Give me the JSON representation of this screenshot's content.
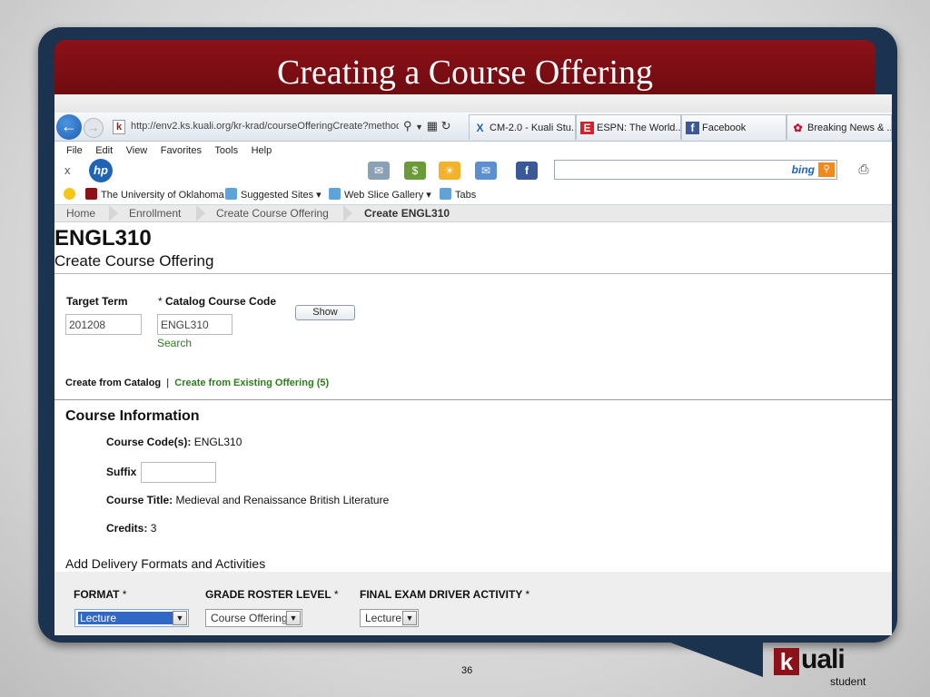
{
  "slide": {
    "title": "Creating a Course Offering",
    "page_number": "36"
  },
  "browser": {
    "url": "http://env2.ks.kuali.org/kr-krad/courseOfferingCreate?method",
    "tabs": [
      {
        "label": "CM-2.0 - Kuali Stu...",
        "icon": "kuali-x-icon"
      },
      {
        "label": "ESPN: The World...",
        "icon": "espn-icon"
      },
      {
        "label": "Facebook",
        "icon": "facebook-icon"
      },
      {
        "label": "Breaking News & ...",
        "icon": "nbc-icon"
      }
    ],
    "menu": [
      "File",
      "Edit",
      "View",
      "Favorites",
      "Tools",
      "Help"
    ],
    "toolbar_close": "x",
    "hp_logo": "hp",
    "bing_label": "bing",
    "favorites": [
      {
        "label": "The University of Oklahoma"
      },
      {
        "label": "Suggested Sites ▾"
      },
      {
        "label": "Web Slice Gallery ▾"
      },
      {
        "label": "Tabs"
      }
    ]
  },
  "breadcrumb": [
    "Home",
    "Enrollment",
    "Create Course Offering",
    "Create ENGL310"
  ],
  "page": {
    "heading": "ENGL310",
    "subheading": "Create Course Offering"
  },
  "form": {
    "target_term_label": "Target Term",
    "target_term_value": "201208",
    "catalog_code_required": "*",
    "catalog_code_label": "Catalog Course Code",
    "catalog_code_value": "ENGL310",
    "search_link": "Search",
    "show_button": "Show"
  },
  "create_options": {
    "from_catalog": "Create from Catalog",
    "separator": "|",
    "from_existing": "Create from Existing Offering (5)"
  },
  "course_info": {
    "title": "Course Information",
    "code_label": "Course Code(s):",
    "code_value": "ENGL310",
    "suffix_label": "Suffix",
    "suffix_value": "",
    "course_title_label": "Course Title:",
    "course_title_value": "Medieval and Renaissance British Literature",
    "credits_label": "Credits:",
    "credits_value": "3"
  },
  "delivery": {
    "title": "Add Delivery Formats and Activities",
    "columns": [
      {
        "label": "FORMAT",
        "required": "*",
        "selected": "Lecture"
      },
      {
        "label": "GRADE ROSTER LEVEL",
        "required": "*",
        "selected": "Course Offering"
      },
      {
        "label": "FINAL EXAM DRIVER ACTIVITY",
        "required": "*",
        "selected": "Lecture"
      }
    ]
  },
  "branding": {
    "logo_letter": "k",
    "logo_word": "uali",
    "logo_sub": "student"
  },
  "colors": {
    "title_band": "#8c1118",
    "frame": "#1c3350",
    "link_green": "#2e7d1e",
    "select_highlight": "#3168c6"
  }
}
